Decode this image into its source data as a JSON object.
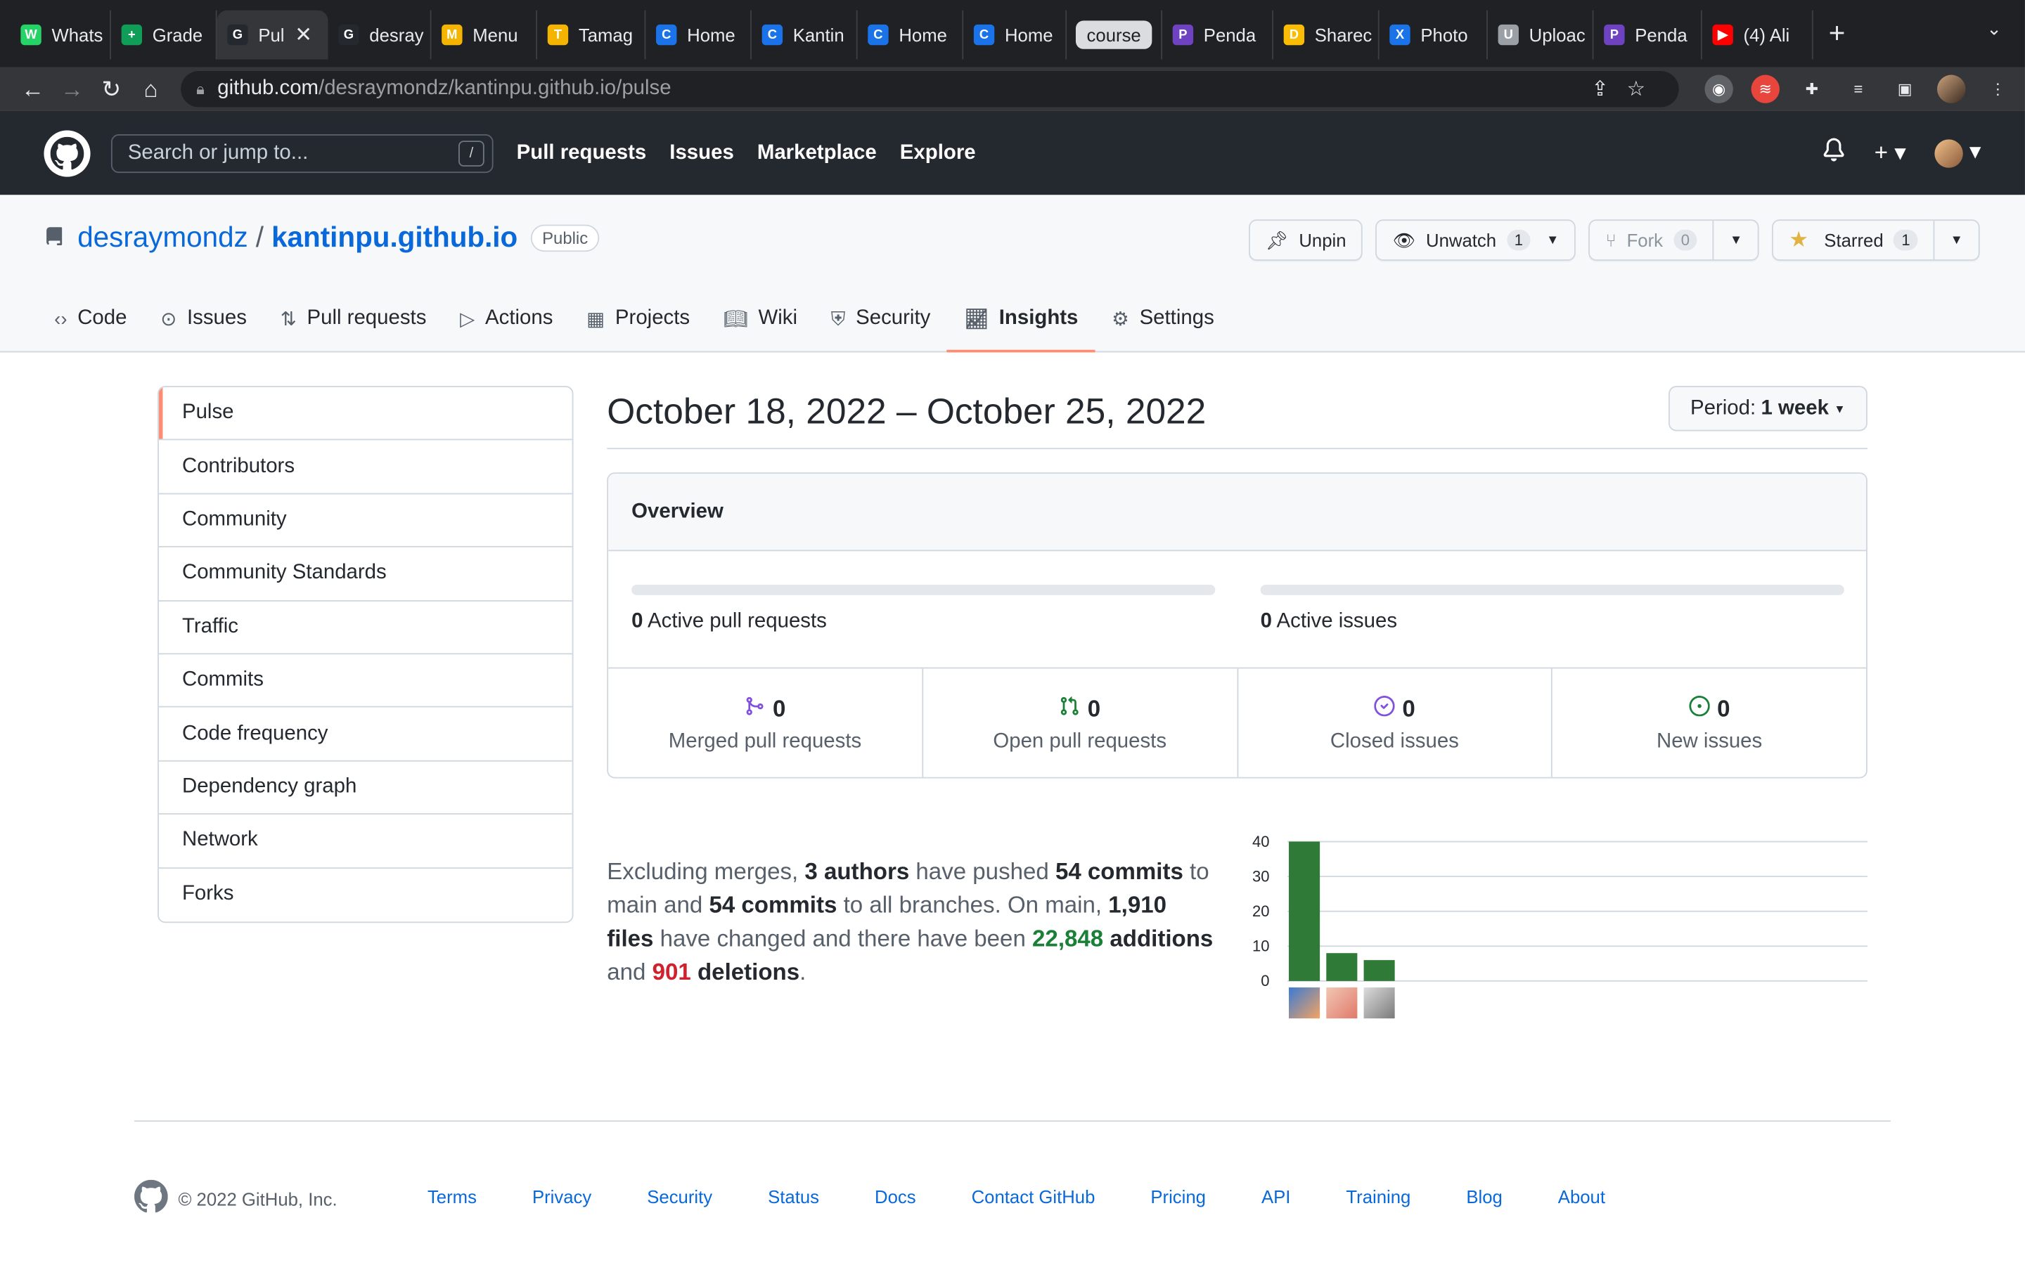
{
  "browser": {
    "tabs": [
      {
        "label": "Whats",
        "color": "#25d366",
        "glyph": "W"
      },
      {
        "label": "Grade",
        "color": "#0f9d58",
        "glyph": "+"
      },
      {
        "label": "Pul",
        "color": "#24292f",
        "glyph": "G",
        "active": true
      },
      {
        "label": "desray",
        "color": "#24292f",
        "glyph": "G"
      },
      {
        "label": "Menu",
        "color": "#f4b400",
        "glyph": "M"
      },
      {
        "label": "Tamag",
        "color": "#f4b400",
        "glyph": "T"
      },
      {
        "label": "Home",
        "color": "#1a73e8",
        "glyph": "C"
      },
      {
        "label": "Kantin",
        "color": "#1a73e8",
        "glyph": "C"
      },
      {
        "label": "Home",
        "color": "#1a73e8",
        "glyph": "C"
      },
      {
        "label": "Home",
        "color": "#1a73e8",
        "glyph": "C"
      },
      {
        "label": "course",
        "course": true
      },
      {
        "label": "Penda",
        "color": "#6f42c1",
        "glyph": "P"
      },
      {
        "label": "Sharec",
        "color": "#fbbc04",
        "glyph": "D"
      },
      {
        "label": "Photo",
        "color": "#1a73e8",
        "glyph": "X"
      },
      {
        "label": "Uploac",
        "color": "#9aa0a6",
        "glyph": "U"
      },
      {
        "label": "Penda",
        "color": "#6f42c1",
        "glyph": "P"
      },
      {
        "label": "(4) Ali",
        "color": "#ff0000",
        "glyph": "▶"
      }
    ],
    "url_host": "github.com",
    "url_path": "/desraymondz/kantinpu.github.io/pulse"
  },
  "gh_header": {
    "search_placeholder": "Search or jump to...",
    "search_key": "/",
    "nav": [
      "Pull requests",
      "Issues",
      "Marketplace",
      "Explore"
    ]
  },
  "repo": {
    "owner": "desraymondz",
    "name": "kantinpu.github.io",
    "visibility": "Public",
    "unpin": "Unpin",
    "unwatch": "Unwatch",
    "watch_count": "1",
    "fork": "Fork",
    "fork_count": "0",
    "starred": "Starred",
    "star_count": "1",
    "tabs": [
      "Code",
      "Issues",
      "Pull requests",
      "Actions",
      "Projects",
      "Wiki",
      "Security",
      "Insights",
      "Settings"
    ],
    "selected_tab": "Insights"
  },
  "sidebar": {
    "items": [
      "Pulse",
      "Contributors",
      "Community",
      "Community Standards",
      "Traffic",
      "Commits",
      "Code frequency",
      "Dependency graph",
      "Network",
      "Forks"
    ]
  },
  "pulse": {
    "date_range": "October 18, 2022 – October 25, 2022",
    "period_label": "Period:",
    "period_value": "1 week",
    "overview_title": "Overview",
    "active_prs_count": "0",
    "active_prs_label": "Active pull requests",
    "active_issues_count": "0",
    "active_issues_label": "Active issues",
    "stats": [
      {
        "count": "0",
        "label": "Merged pull requests",
        "icon": "merge-icon",
        "color": "#8250df"
      },
      {
        "count": "0",
        "label": "Open pull requests",
        "icon": "pull-request-icon",
        "color": "#1a7f37"
      },
      {
        "count": "0",
        "label": "Closed issues",
        "icon": "issue-closed-icon",
        "color": "#8250df"
      },
      {
        "count": "0",
        "label": "New issues",
        "icon": "issue-opened-icon",
        "color": "#1a7f37"
      }
    ],
    "summary": {
      "t1": "Excluding merges, ",
      "authors": "3 authors",
      "t2": " have pushed ",
      "commits_main": "54 commits",
      "t3": " to main and ",
      "commits_all": "54 commits",
      "t4": " to all branches. On main, ",
      "files": "1,910 files",
      "t5": " have changed and there have been ",
      "additions_num": "22,848",
      "additions_word": " additions",
      "t6": " and ",
      "deletions_num": "901",
      "deletions_word": " deletions",
      "t7": "."
    }
  },
  "chart_data": {
    "type": "bar",
    "categories": [
      "author-1",
      "author-2",
      "author-3"
    ],
    "values": [
      40,
      8,
      6
    ],
    "yticks": [
      "0",
      "10",
      "20",
      "30",
      "40"
    ],
    "ylim": [
      0,
      40
    ],
    "bar_color": "#2f7a36",
    "grid": true
  },
  "footer": {
    "copyright": "© 2022 GitHub, Inc.",
    "links": [
      "Terms",
      "Privacy",
      "Security",
      "Status",
      "Docs",
      "Contact GitHub",
      "Pricing",
      "API",
      "Training",
      "Blog",
      "About"
    ]
  }
}
